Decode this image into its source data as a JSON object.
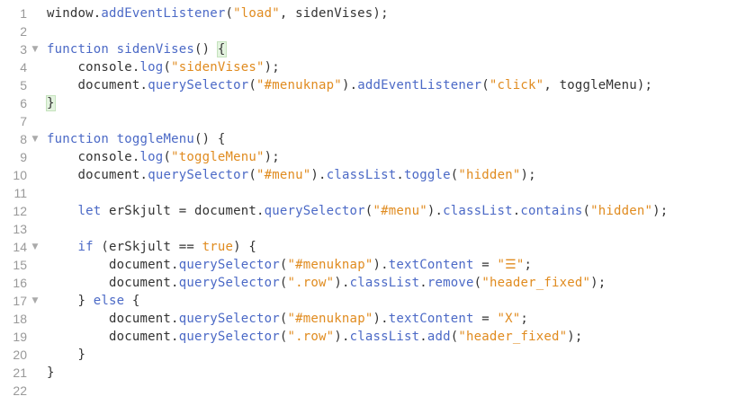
{
  "editor": {
    "colors": {
      "keyword": "#4b69c6",
      "string": "#e08b1f",
      "text": "#333333",
      "gutter": "#999999",
      "bracket_highlight": "#e3f3df"
    },
    "lines": [
      {
        "num": "1",
        "fold": false,
        "indent": "",
        "tokens": [
          {
            "t": "window.",
            "c": "id"
          },
          {
            "t": "addEventListener",
            "c": "mt"
          },
          {
            "t": "(",
            "c": "id"
          },
          {
            "t": "\"load\"",
            "c": "st"
          },
          {
            "t": ", sidenVises);",
            "c": "id"
          }
        ]
      },
      {
        "num": "2",
        "fold": false,
        "indent": "",
        "tokens": []
      },
      {
        "num": "3",
        "fold": true,
        "indent": "",
        "tokens": [
          {
            "t": "function",
            "c": "kw"
          },
          {
            "t": " ",
            "c": "id"
          },
          {
            "t": "sidenVises",
            "c": "mt"
          },
          {
            "t": "() ",
            "c": "id"
          },
          {
            "t": "{",
            "c": "id",
            "hl": true
          }
        ]
      },
      {
        "num": "4",
        "fold": false,
        "indent": "    ",
        "tokens": [
          {
            "t": "console.",
            "c": "id"
          },
          {
            "t": "log",
            "c": "mt"
          },
          {
            "t": "(",
            "c": "id"
          },
          {
            "t": "\"sidenVises\"",
            "c": "st"
          },
          {
            "t": ");",
            "c": "id"
          }
        ]
      },
      {
        "num": "5",
        "fold": false,
        "indent": "    ",
        "tokens": [
          {
            "t": "document.",
            "c": "id"
          },
          {
            "t": "querySelector",
            "c": "mt"
          },
          {
            "t": "(",
            "c": "id"
          },
          {
            "t": "\"#menuknap\"",
            "c": "st"
          },
          {
            "t": ").",
            "c": "id"
          },
          {
            "t": "addEventListener",
            "c": "mt"
          },
          {
            "t": "(",
            "c": "id"
          },
          {
            "t": "\"click\"",
            "c": "st"
          },
          {
            "t": ", toggleMenu);",
            "c": "id"
          }
        ]
      },
      {
        "num": "6",
        "fold": false,
        "indent": "",
        "tokens": [
          {
            "t": "}",
            "c": "id",
            "hl": true
          }
        ]
      },
      {
        "num": "7",
        "fold": false,
        "indent": "",
        "tokens": []
      },
      {
        "num": "8",
        "fold": true,
        "indent": "",
        "tokens": [
          {
            "t": "function",
            "c": "kw"
          },
          {
            "t": " ",
            "c": "id"
          },
          {
            "t": "toggleMenu",
            "c": "mt"
          },
          {
            "t": "() {",
            "c": "id"
          }
        ]
      },
      {
        "num": "9",
        "fold": false,
        "indent": "    ",
        "tokens": [
          {
            "t": "console.",
            "c": "id"
          },
          {
            "t": "log",
            "c": "mt"
          },
          {
            "t": "(",
            "c": "id"
          },
          {
            "t": "\"toggleMenu\"",
            "c": "st"
          },
          {
            "t": ");",
            "c": "id"
          }
        ]
      },
      {
        "num": "10",
        "fold": false,
        "indent": "    ",
        "tokens": [
          {
            "t": "document.",
            "c": "id"
          },
          {
            "t": "querySelector",
            "c": "mt"
          },
          {
            "t": "(",
            "c": "id"
          },
          {
            "t": "\"#menu\"",
            "c": "st"
          },
          {
            "t": ").",
            "c": "id"
          },
          {
            "t": "classList",
            "c": "mt"
          },
          {
            "t": ".",
            "c": "id"
          },
          {
            "t": "toggle",
            "c": "mt"
          },
          {
            "t": "(",
            "c": "id"
          },
          {
            "t": "\"hidden\"",
            "c": "st"
          },
          {
            "t": ");",
            "c": "id"
          }
        ]
      },
      {
        "num": "11",
        "fold": false,
        "indent": "",
        "tokens": []
      },
      {
        "num": "12",
        "fold": false,
        "indent": "    ",
        "tokens": [
          {
            "t": "let",
            "c": "kw"
          },
          {
            "t": " erSkjult = document.",
            "c": "id"
          },
          {
            "t": "querySelector",
            "c": "mt"
          },
          {
            "t": "(",
            "c": "id"
          },
          {
            "t": "\"#menu\"",
            "c": "st"
          },
          {
            "t": ").",
            "c": "id"
          },
          {
            "t": "classList",
            "c": "mt"
          },
          {
            "t": ".",
            "c": "id"
          },
          {
            "t": "contains",
            "c": "mt"
          },
          {
            "t": "(",
            "c": "id"
          },
          {
            "t": "\"hidden\"",
            "c": "st"
          },
          {
            "t": ");",
            "c": "id"
          }
        ]
      },
      {
        "num": "13",
        "fold": false,
        "indent": "",
        "tokens": []
      },
      {
        "num": "14",
        "fold": true,
        "indent": "    ",
        "tokens": [
          {
            "t": "if",
            "c": "kw"
          },
          {
            "t": " (erSkjult == ",
            "c": "id"
          },
          {
            "t": "true",
            "c": "st"
          },
          {
            "t": ") {",
            "c": "id"
          }
        ]
      },
      {
        "num": "15",
        "fold": false,
        "indent": "        ",
        "tokens": [
          {
            "t": "document.",
            "c": "id"
          },
          {
            "t": "querySelector",
            "c": "mt"
          },
          {
            "t": "(",
            "c": "id"
          },
          {
            "t": "\"#menuknap\"",
            "c": "st"
          },
          {
            "t": ").",
            "c": "id"
          },
          {
            "t": "textContent",
            "c": "mt"
          },
          {
            "t": " = ",
            "c": "id"
          },
          {
            "t": "\"☰\"",
            "c": "st"
          },
          {
            "t": ";",
            "c": "id"
          }
        ]
      },
      {
        "num": "16",
        "fold": false,
        "indent": "        ",
        "tokens": [
          {
            "t": "document.",
            "c": "id"
          },
          {
            "t": "querySelector",
            "c": "mt"
          },
          {
            "t": "(",
            "c": "id"
          },
          {
            "t": "\".row\"",
            "c": "st"
          },
          {
            "t": ").",
            "c": "id"
          },
          {
            "t": "classList",
            "c": "mt"
          },
          {
            "t": ".",
            "c": "id"
          },
          {
            "t": "remove",
            "c": "mt"
          },
          {
            "t": "(",
            "c": "id"
          },
          {
            "t": "\"header_fixed\"",
            "c": "st"
          },
          {
            "t": ");",
            "c": "id"
          }
        ]
      },
      {
        "num": "17",
        "fold": true,
        "indent": "    ",
        "tokens": [
          {
            "t": "} ",
            "c": "id"
          },
          {
            "t": "else",
            "c": "kw"
          },
          {
            "t": " {",
            "c": "id"
          }
        ]
      },
      {
        "num": "18",
        "fold": false,
        "indent": "        ",
        "tokens": [
          {
            "t": "document.",
            "c": "id"
          },
          {
            "t": "querySelector",
            "c": "mt"
          },
          {
            "t": "(",
            "c": "id"
          },
          {
            "t": "\"#menuknap\"",
            "c": "st"
          },
          {
            "t": ").",
            "c": "id"
          },
          {
            "t": "textContent",
            "c": "mt"
          },
          {
            "t": " = ",
            "c": "id"
          },
          {
            "t": "\"X\"",
            "c": "st"
          },
          {
            "t": ";",
            "c": "id"
          }
        ]
      },
      {
        "num": "19",
        "fold": false,
        "indent": "        ",
        "tokens": [
          {
            "t": "document.",
            "c": "id"
          },
          {
            "t": "querySelector",
            "c": "mt"
          },
          {
            "t": "(",
            "c": "id"
          },
          {
            "t": "\".row\"",
            "c": "st"
          },
          {
            "t": ").",
            "c": "id"
          },
          {
            "t": "classList",
            "c": "mt"
          },
          {
            "t": ".",
            "c": "id"
          },
          {
            "t": "add",
            "c": "mt"
          },
          {
            "t": "(",
            "c": "id"
          },
          {
            "t": "\"header_fixed\"",
            "c": "st"
          },
          {
            "t": ");",
            "c": "id"
          }
        ]
      },
      {
        "num": "20",
        "fold": false,
        "indent": "    ",
        "tokens": [
          {
            "t": "}",
            "c": "id"
          }
        ]
      },
      {
        "num": "21",
        "fold": false,
        "indent": "",
        "tokens": [
          {
            "t": "}",
            "c": "id"
          }
        ]
      },
      {
        "num": "22",
        "fold": false,
        "indent": "",
        "tokens": []
      }
    ]
  }
}
